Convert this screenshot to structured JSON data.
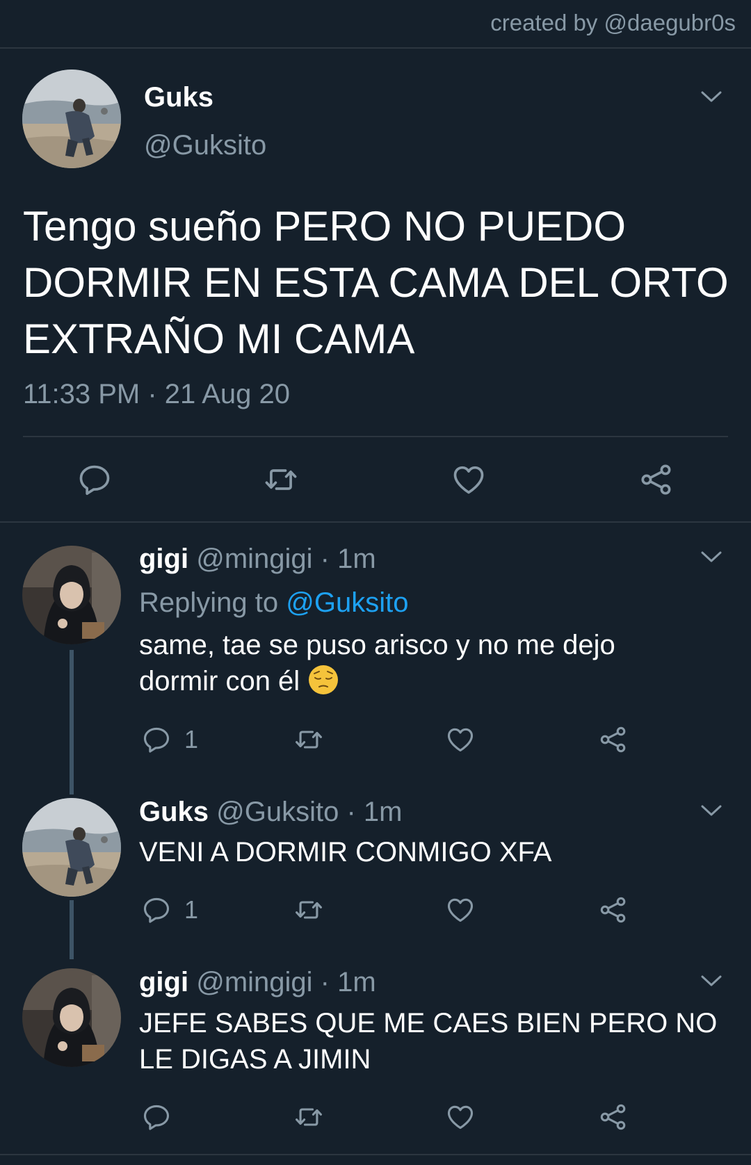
{
  "credit": "created by @daegubr0s",
  "main_tweet": {
    "name": "Guks",
    "handle": "@Guksito",
    "text_lines": [
      "Tengo sueño PERO NO PUEDO",
      "DORMIR EN ESTA CAMA DEL ORTO",
      "EXTRAÑO MI CAMA"
    ],
    "timestamp": "11:33 PM · 21 Aug 20"
  },
  "replies": [
    {
      "name": "gigi",
      "meta": "@mingigi · 1m",
      "replying_prefix": "Replying to ",
      "replying_handle": "@Guksito",
      "text_line1": "same, tae se puso arisco y no me dejo",
      "text_line2": "dormir con él",
      "emoji": "pensive-face",
      "reply_count": "1"
    },
    {
      "name": "Guks",
      "meta": "@Guksito · 1m",
      "text_line1": "VENI A DORMIR CONMIGO XFA",
      "reply_count": "1"
    },
    {
      "name": "gigi",
      "meta": "@mingigi · 1m",
      "text_line1": "JEFE SABES QUE ME CAES BIEN PERO NO",
      "text_line2": "LE DIGAS A JIMIN",
      "reply_count": ""
    }
  ],
  "colors": {
    "background": "#15202b",
    "text": "#ffffff",
    "muted": "#8899a6",
    "link": "#1da1f2",
    "divider": "#2c3640",
    "thread_line": "#3d5466"
  },
  "icons": [
    "reply-icon",
    "retweet-icon",
    "like-icon",
    "share-icon",
    "chevron-down-icon"
  ]
}
